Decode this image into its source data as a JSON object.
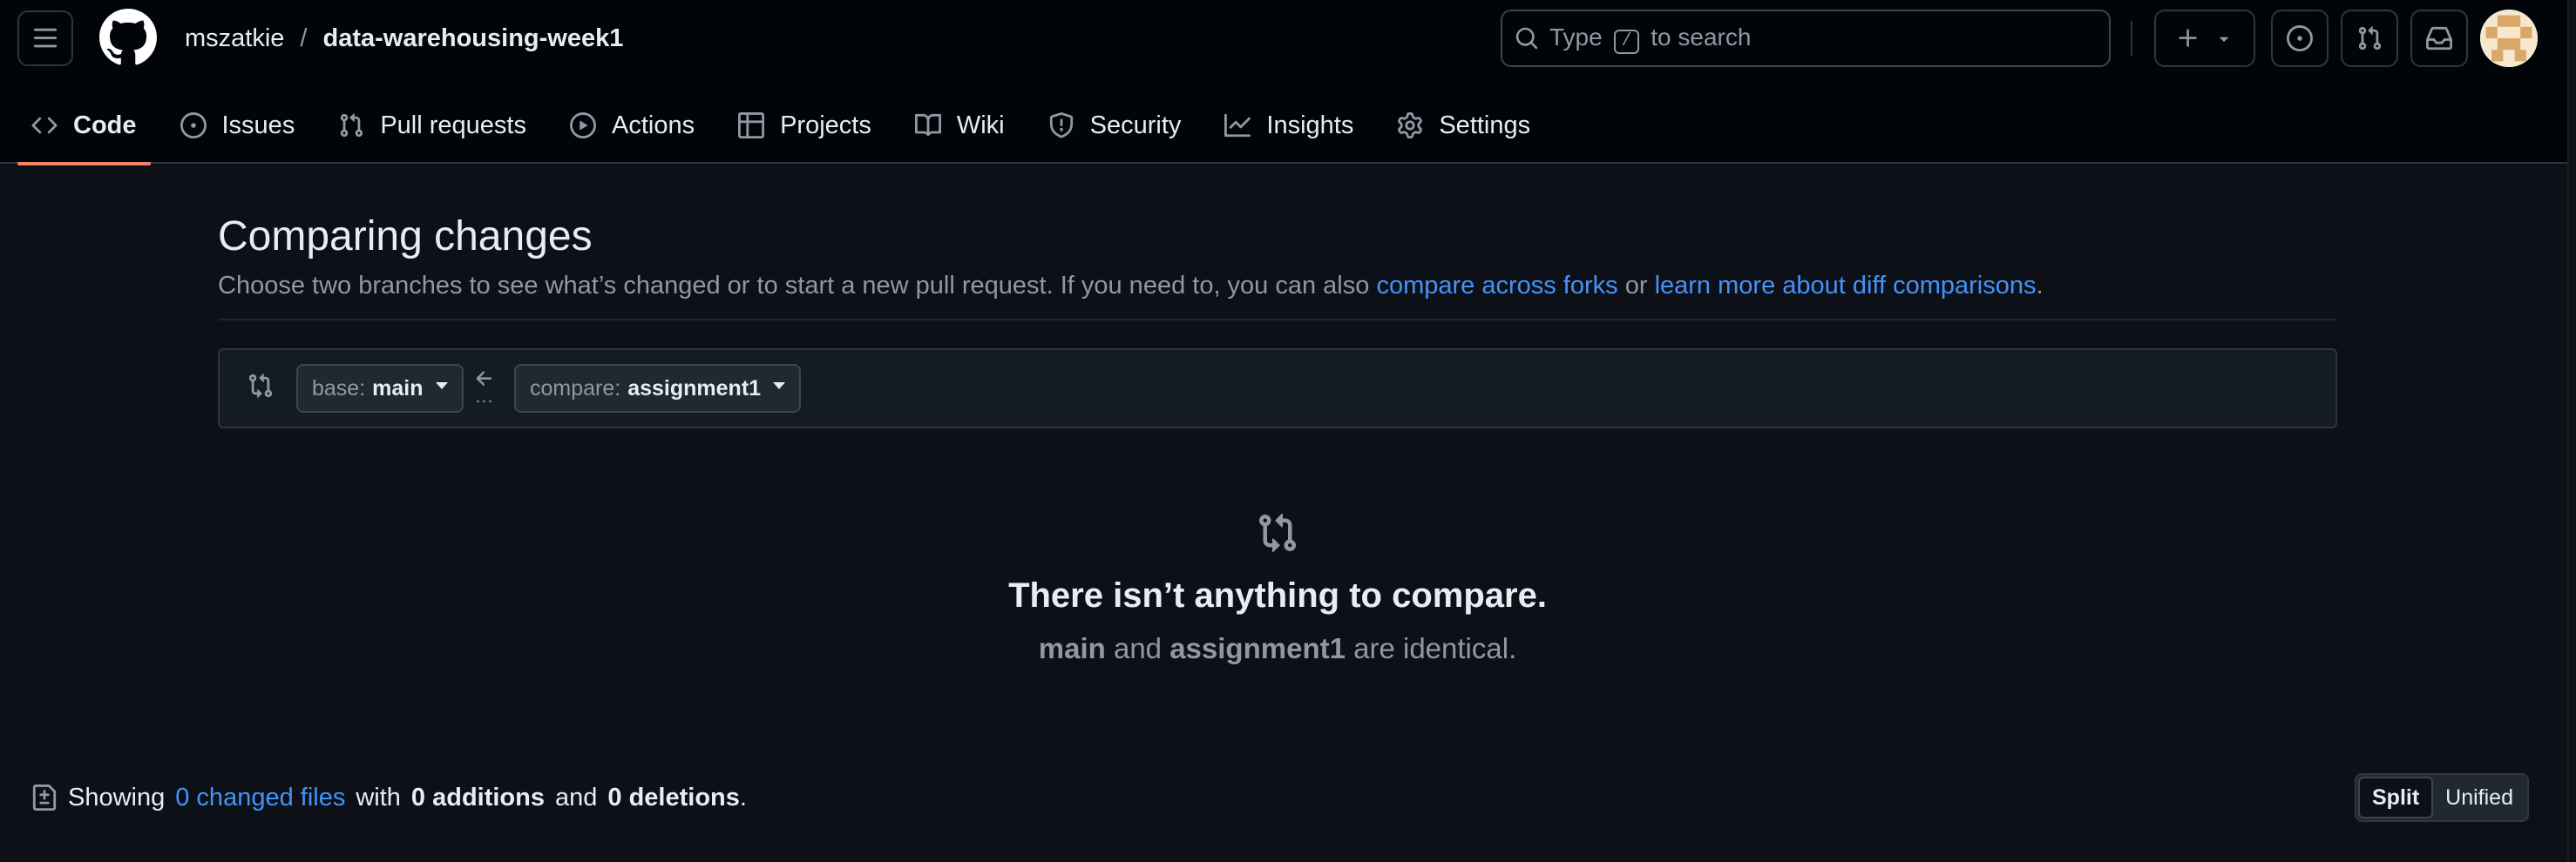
{
  "header": {
    "owner": "mszatkie",
    "separator": "/",
    "repo": "data-warehousing-week1",
    "search_prefix": "Type",
    "search_key": "/",
    "search_suffix": "to search"
  },
  "repo_nav": {
    "tabs": [
      {
        "label": "Code",
        "icon": "code-icon",
        "active": true
      },
      {
        "label": "Issues",
        "icon": "issue-icon"
      },
      {
        "label": "Pull requests",
        "icon": "pull-request-icon"
      },
      {
        "label": "Actions",
        "icon": "play-icon"
      },
      {
        "label": "Projects",
        "icon": "table-icon"
      },
      {
        "label": "Wiki",
        "icon": "book-icon"
      },
      {
        "label": "Security",
        "icon": "shield-icon"
      },
      {
        "label": "Insights",
        "icon": "graph-icon"
      },
      {
        "label": "Settings",
        "icon": "gear-icon"
      }
    ]
  },
  "compare": {
    "title": "Comparing changes",
    "subtitle_text": "Choose two branches to see what’s changed or to start a new pull request. If you need to, you can also",
    "link_forks": "compare across forks",
    "or_text": "or",
    "link_learn": "learn more about diff comparisons",
    "period": ".",
    "base_label": "base:",
    "base_branch": "main",
    "compare_label": "compare:",
    "compare_branch": "assignment1",
    "dots": "...",
    "blank_title": "There isn’t anything to compare.",
    "blank_branch_a": "main",
    "blank_and": "and",
    "blank_branch_b": "assignment1",
    "blank_tail": "are identical."
  },
  "summary": {
    "showing": "Showing",
    "files_link": "0 changed files",
    "with": "with",
    "additions": "0 additions",
    "and": "and",
    "deletions": "0 deletions",
    "period": "."
  },
  "view_toggle": {
    "split": "Split",
    "unified": "Unified",
    "selected": "Split"
  },
  "colors": {
    "background": "#0d1117",
    "header_bg": "#010409",
    "link": "#4493f8",
    "active_tab_underline": "#f78166"
  }
}
